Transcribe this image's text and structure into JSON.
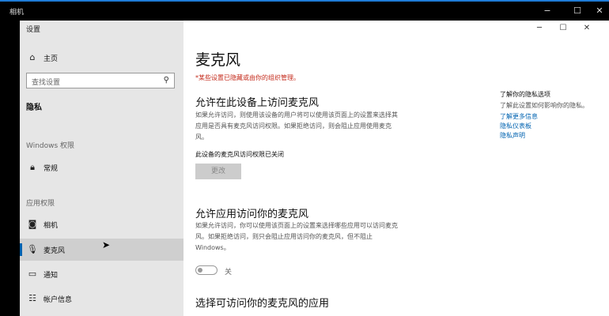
{
  "camera_window": {
    "title": "相机",
    "controls": [
      "−",
      "☐",
      "✕"
    ]
  },
  "settings_window": {
    "title": "设置",
    "controls": [
      "─",
      "☐",
      "✕"
    ]
  },
  "sidebar": {
    "home": "主页",
    "search_placeholder": "查找设置",
    "section": "隐私",
    "group_windows": "Windows 权限",
    "general": "常规",
    "group_app": "应用权限",
    "items": [
      {
        "label": "相机",
        "icon": "camera-icon"
      },
      {
        "label": "麦克风",
        "icon": "microphone-icon",
        "selected": true
      },
      {
        "label": "通知",
        "icon": "notification-icon"
      },
      {
        "label": "帐户信息",
        "icon": "account-info-icon"
      }
    ]
  },
  "main": {
    "title": "麦克风",
    "warning": "*某些设置已隐藏或由你的组织管理。",
    "section1": {
      "heading": "允许在此设备上访问麦克风",
      "desc_line1": "如果允许访问，则使用该设备的用户将可以使用该页面上的设置来选择其",
      "desc_line2": "应用是否具有麦克风访问权限。如果拒绝访问，则会阻止应用使用麦克",
      "desc_line3": "风。",
      "status": "此设备的麦克风访问权限已关闭",
      "button": "更改"
    },
    "section2": {
      "heading": "允许应用访问你的麦克风",
      "desc_line1": "如果允许访问，你可以使用该页面上的设置来选择哪些应用可以访问麦克",
      "desc_line2": "风。如果拒绝访问，则只会阻止应用访问你的麦克风，但不阻止",
      "desc_line3": "Windows。",
      "toggle_label": "关"
    },
    "section3": {
      "heading": "选择可访问你的麦克风的应用"
    }
  },
  "aside": {
    "heading": "了解你的隐私选项",
    "desc": "了解此设置如何影响你的隐私。",
    "links": [
      "了解更多信息",
      "隐私仪表板",
      "隐私声明"
    ]
  }
}
